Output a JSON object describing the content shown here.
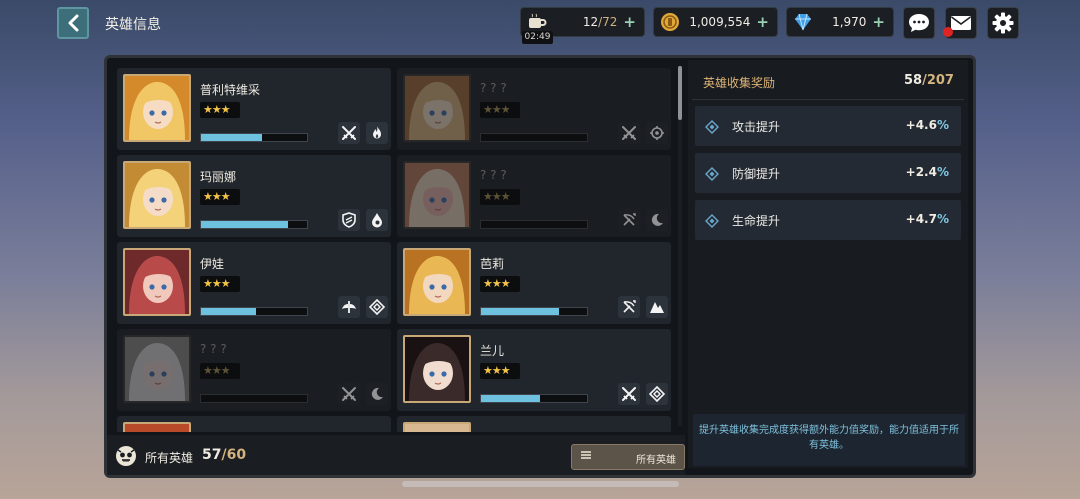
{
  "header": {
    "title": "英雄信息"
  },
  "resources": {
    "stamina": {
      "value": "12",
      "max": "72",
      "timer": "02:49"
    },
    "gold": {
      "value": "1,009,554"
    },
    "gems": {
      "value": "1,970"
    }
  },
  "heroes": [
    {
      "name": "普利特维采",
      "stars": "★★★",
      "locked": false,
      "progress": 0.58,
      "tags": [
        "swords-icon",
        "fire-icon"
      ]
    },
    {
      "name": "? ? ?",
      "stars": "★★★",
      "locked": true,
      "progress": 0,
      "tags": [
        "swords-icon",
        "gear-icon"
      ]
    },
    {
      "name": "玛丽娜",
      "stars": "★★★",
      "locked": false,
      "progress": 0.82,
      "tags": [
        "shield-icon",
        "water-icon"
      ]
    },
    {
      "name": "? ? ?",
      "stars": "★★★",
      "locked": true,
      "progress": 0,
      "tags": [
        "crossed-bow-icon",
        "moon-icon"
      ]
    },
    {
      "name": "伊娃",
      "stars": "★★★",
      "locked": false,
      "progress": 0.52,
      "tags": [
        "angel-icon",
        "diamond-icon"
      ]
    },
    {
      "name": "芭莉",
      "stars": "★★★",
      "locked": false,
      "progress": 0.74,
      "tags": [
        "crossed-bow-icon",
        "mountain-icon"
      ]
    },
    {
      "name": "? ? ?",
      "stars": "★★★",
      "locked": true,
      "progress": 0,
      "tags": [
        "swords-icon",
        "moon-icon"
      ]
    },
    {
      "name": "兰儿",
      "stars": "★★★",
      "locked": false,
      "progress": 0.56,
      "tags": [
        "swords-icon",
        "diamond-icon"
      ]
    }
  ],
  "collection": {
    "label": "所有英雄",
    "count": "57",
    "total": "60"
  },
  "filter": {
    "label": "所有英雄"
  },
  "reward": {
    "title": "英雄收集奖励",
    "count": "58",
    "total": "207",
    "stats": [
      {
        "name": "攻击提升",
        "value": "+4.6",
        "unit": "%"
      },
      {
        "name": "防御提升",
        "value": "+2.4",
        "unit": "%"
      },
      {
        "name": "生命提升",
        "value": "+4.7",
        "unit": "%"
      }
    ],
    "description": "提升英雄收集完成度获得额外能力值奖励，能力值适用于所有英雄。"
  }
}
